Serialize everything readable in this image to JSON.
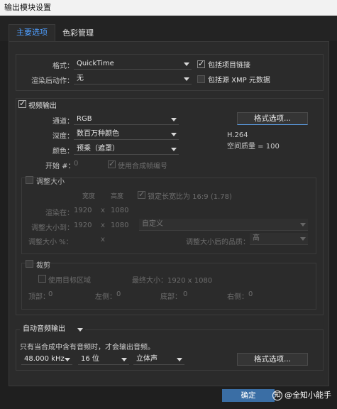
{
  "window": {
    "title": "输出模块设置"
  },
  "tabs": [
    {
      "label": "主要选项"
    },
    {
      "label": "色彩管理"
    }
  ],
  "top": {
    "format_label": "格式：",
    "format_value": "QuickTime",
    "post_render_label": "渲染后动作：",
    "post_render_value": "无",
    "include_project_link": "包括项目链接",
    "include_xmp": "包括源 XMP 元数据"
  },
  "video": {
    "section_label": "视频输出",
    "channels_label": "通道：",
    "channels_value": "RGB",
    "depth_label": "深度：",
    "depth_value": "数百万种颜色",
    "color_label": "颜色：",
    "color_value": "预乘（遮罩）",
    "start_label": "开始 #：",
    "start_value": "0",
    "use_comp_frame": "使用合成帧编号",
    "format_options_button": "格式选项...",
    "codec_info": "H.264",
    "quality_info": "空间质量 = 100"
  },
  "resize": {
    "section_label": "调整大小",
    "width_header": "宽度",
    "height_header": "高度",
    "lock_aspect": "锁定长宽比为 16:9 (1.78)",
    "rendering_at_label": "渲染在：",
    "rendering_w": "1920",
    "rendering_h": "1080",
    "resize_to_label": "调整大小到：",
    "resize_to_w": "1920",
    "resize_to_h": "1080",
    "resize_preset": "自定义",
    "resize_pct_label": "调整大小 %：",
    "quality_label": "调整大小后的品质：",
    "quality_value": "高",
    "times": "x"
  },
  "crop": {
    "section_label": "裁剪",
    "use_roi": "使用目标区域",
    "final_size": "最终大小：1920 x 1080",
    "top_label": "顶部：",
    "top_value": "0",
    "left_label": "左侧：",
    "left_value": "0",
    "bottom_label": "底部：",
    "bottom_value": "0",
    "right_label": "右侧：",
    "right_value": "0"
  },
  "audio": {
    "mode_value": "自动音频输出",
    "note": "只有当合成中含有音频时，才会输出音频。",
    "rate_value": "48.000 kHz",
    "bits_value": "16 位",
    "channels_value": "立体声",
    "format_options_button": "格式选项..."
  },
  "footer": {
    "ok_button": "确定",
    "watermark": "@全知小能手"
  }
}
